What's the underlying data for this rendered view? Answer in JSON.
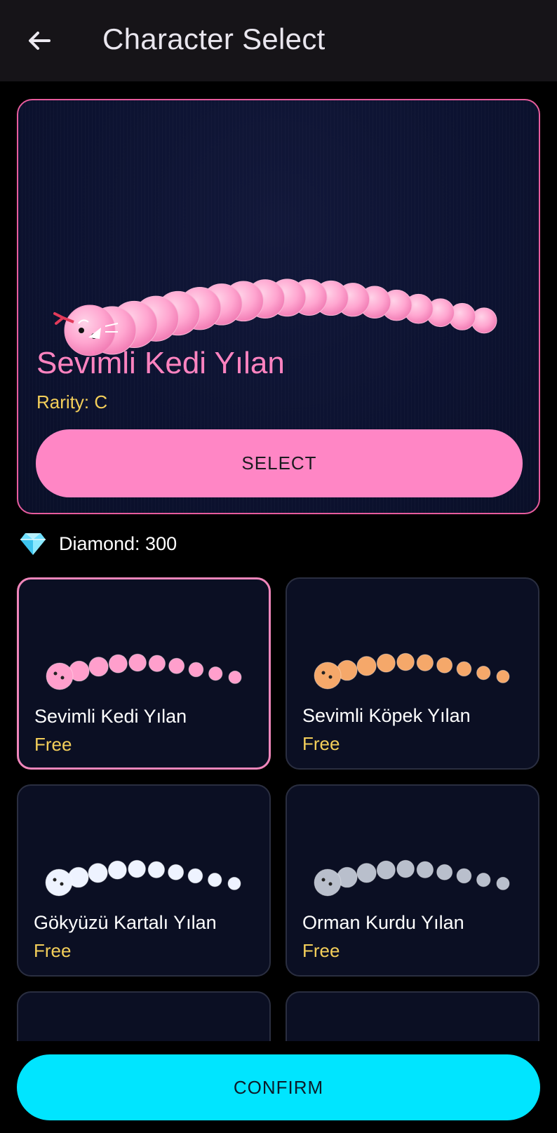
{
  "header": {
    "title": "Character Select",
    "back_icon": "arrow-left-icon"
  },
  "featured": {
    "name": "Sevimli Kedi Yılan",
    "rarity": "Rarity: C",
    "select_label": "SELECT",
    "accent_color": "#ff86c5",
    "border_color": "#e75c9d"
  },
  "wallet": {
    "icon": "diamond-icon",
    "label": "Diamond: 300"
  },
  "characters": [
    {
      "name": "Sevimli Kedi Yılan",
      "price": "Free",
      "color": "#ff9fcc",
      "selected": true
    },
    {
      "name": "Sevimli Köpek Yılan",
      "price": "Free",
      "color": "#f5a86a",
      "selected": false
    },
    {
      "name": "Gökyüzü Kartalı Yılan",
      "price": "Free",
      "color": "#eef3ff",
      "selected": false
    },
    {
      "name": "Orman Kurdu Yılan",
      "price": "Free",
      "color": "#b9bfcc",
      "selected": false
    }
  ],
  "footer": {
    "confirm_label": "CONFIRM",
    "confirm_color": "#00e5ff"
  }
}
